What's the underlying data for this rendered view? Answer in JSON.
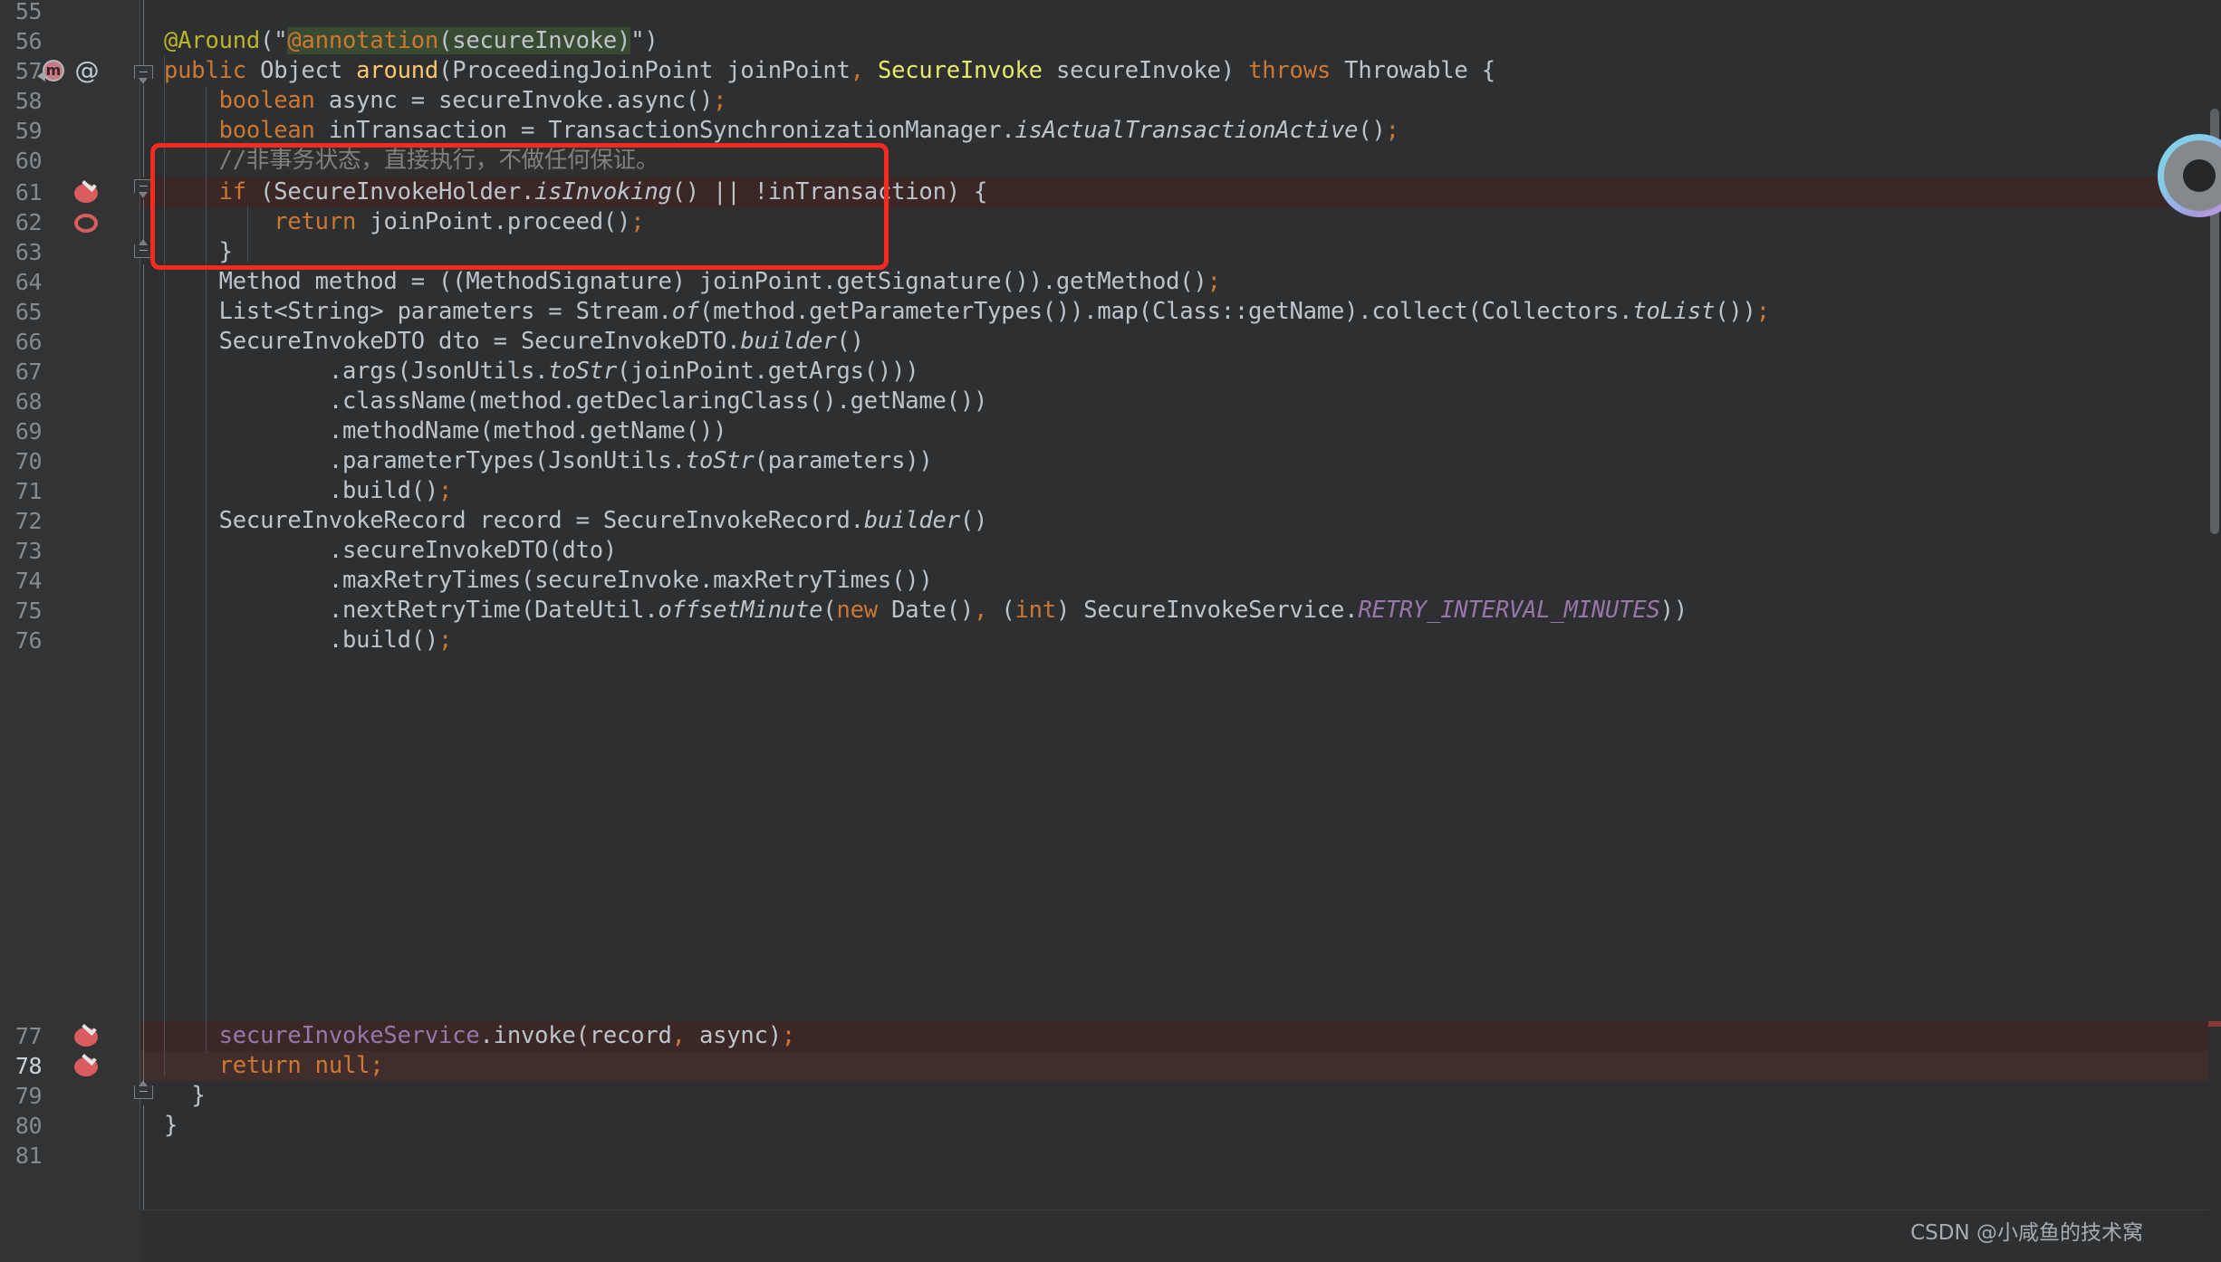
{
  "editor": {
    "theme_background": "#2d2f31",
    "gutter_background": "#313335",
    "caret_line_color": "#3a3c3e",
    "breakpoint_line_color": "#3c2727",
    "annotation_box_color": "#fa2a1e",
    "lines": [
      {
        "num": "55",
        "indent": 0,
        "text": ""
      },
      {
        "num": "56",
        "indent": 0,
        "text": "@Around(\"@annotation(secureInvoke)\")"
      },
      {
        "num": "57",
        "indent": 0,
        "text": "public Object around(ProceedingJoinPoint joinPoint, SecureInvoke secureInvoke) throws Throwable {"
      },
      {
        "num": "58",
        "indent": 1,
        "text": "boolean async = secureInvoke.async();"
      },
      {
        "num": "59",
        "indent": 1,
        "text": "boolean inTransaction = TransactionSynchronizationManager.isActualTransactionActive();"
      },
      {
        "num": "60",
        "indent": 1,
        "text": "//非事务状态，直接执行，不做任何保证。"
      },
      {
        "num": "61",
        "indent": 1,
        "text": "if (SecureInvokeHolder.isInvoking() || !inTransaction) {"
      },
      {
        "num": "62",
        "indent": 2,
        "text": "return joinPoint.proceed();"
      },
      {
        "num": "63",
        "indent": 1,
        "text": "}"
      },
      {
        "num": "64",
        "indent": 1,
        "text": "Method method = ((MethodSignature) joinPoint.getSignature()).getMethod();"
      },
      {
        "num": "65",
        "indent": 1,
        "text": "List<String> parameters = Stream.of(method.getParameterTypes()).map(Class::getName).collect(Collectors.toList());"
      },
      {
        "num": "66",
        "indent": 1,
        "text": "SecureInvokeDTO dto = SecureInvokeDTO.builder()"
      },
      {
        "num": "67",
        "indent": 3,
        "text": ".args(JsonUtils.toStr(joinPoint.getArgs()))"
      },
      {
        "num": "68",
        "indent": 3,
        "text": ".className(method.getDeclaringClass().getName())"
      },
      {
        "num": "69",
        "indent": 3,
        "text": ".methodName(method.getName())"
      },
      {
        "num": "70",
        "indent": 3,
        "text": ".parameterTypes(JsonUtils.toStr(parameters))"
      },
      {
        "num": "71",
        "indent": 3,
        "text": ".build();"
      },
      {
        "num": "72",
        "indent": 1,
        "text": "SecureInvokeRecord record = SecureInvokeRecord.builder()"
      },
      {
        "num": "73",
        "indent": 3,
        "text": ".secureInvokeDTO(dto)"
      },
      {
        "num": "74",
        "indent": 3,
        "text": ".maxRetryTimes(secureInvoke.maxRetryTimes())"
      },
      {
        "num": "75",
        "indent": 3,
        "text": ".nextRetryTime(DateUtil.offsetMinute(new Date(), (int) SecureInvokeService.RETRY_INTERVAL_MINUTES))"
      },
      {
        "num": "76",
        "indent": 3,
        "text": ".build();"
      },
      {
        "num": "77",
        "indent": 1,
        "text": "secureInvokeService.invoke(record, async);"
      },
      {
        "num": "78",
        "indent": 1,
        "text": "return null;"
      },
      {
        "num": "79",
        "indent": 0,
        "text": "}"
      },
      {
        "num": "80",
        "indent": 0,
        "text": "}"
      },
      {
        "num": "81",
        "indent": 0,
        "text": ""
      }
    ],
    "visible_line_numbers": [
      "55",
      "56",
      "57",
      "58",
      "59",
      "60",
      "61",
      "62",
      "63",
      "64",
      "65",
      "66",
      "67",
      "68",
      "69",
      "70",
      "71",
      "72",
      "73",
      "74",
      "75",
      "76",
      "77",
      "78",
      "79",
      "80",
      "81"
    ],
    "current_line_number": "78",
    "gutter_icons": [
      {
        "line": "57",
        "icon": "method-override-icon",
        "label": "m"
      },
      {
        "line": "57",
        "icon": "annotation-at-icon",
        "label": "@"
      },
      {
        "line": "61",
        "icon": "breakpoint-verified-icon",
        "label": ""
      },
      {
        "line": "62",
        "icon": "breakpoint-hollow-icon",
        "label": ""
      },
      {
        "line": "77",
        "icon": "breakpoint-verified-icon",
        "label": ""
      },
      {
        "line": "78",
        "icon": "breakpoint-verified-icon",
        "label": ""
      }
    ],
    "string_highlight_text": "@annotation(secureInvoke)",
    "annotation_box": {
      "label": "red-highlight-box",
      "covers_lines": [
        "60",
        "61",
        "62",
        "63"
      ],
      "color": "#fa2a1e"
    }
  },
  "watermark": {
    "text": "CSDN @小咸鱼的技术窝"
  },
  "widgets": {
    "ai_assistant_label": "ai-assistant-orb"
  }
}
